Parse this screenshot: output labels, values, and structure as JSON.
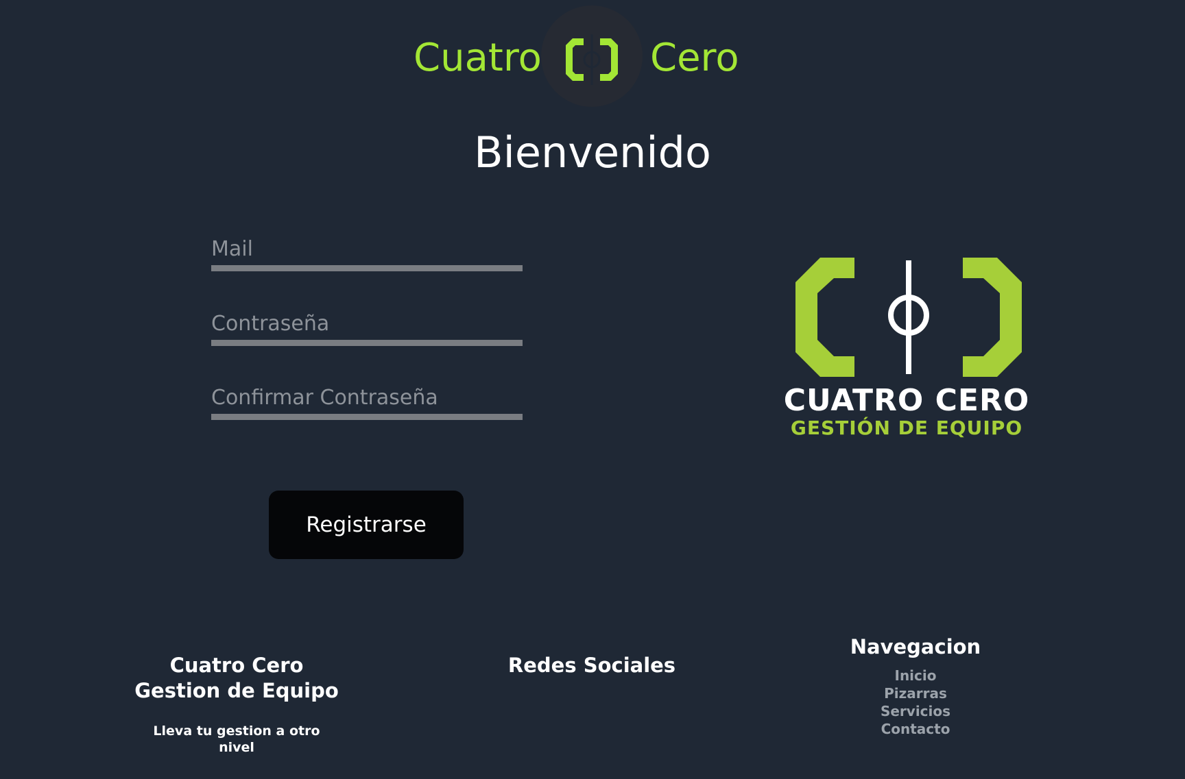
{
  "header": {
    "brand_left": "Cuatro",
    "brand_right": "Cero",
    "logo_icon": "cuatro-cero-logo-icon"
  },
  "welcome": "Bienvenido",
  "form": {
    "mail_placeholder": "Mail",
    "password_placeholder": "Contraseña",
    "confirm_placeholder": "Confirmar Contraseña",
    "submit_label": "Registrarse"
  },
  "brand_logo": {
    "title": "CUATRO CERO",
    "subtitle": "GESTIÓN DE EQUIPO"
  },
  "footer": {
    "brand_line1": "Cuatro Cero",
    "brand_line2": "Gestion de Equipo",
    "tagline": "Lleva tu gestion a otro nivel",
    "social_title": "Redes Sociales",
    "nav_title": "Navegacion",
    "nav_links": [
      "Inicio",
      "Pizarras",
      "Servicios",
      "Contacto"
    ]
  },
  "colors": {
    "background": "#1f2835",
    "accent": "#a3e635",
    "logo_green": "#a6cf39",
    "button": "#050608"
  }
}
